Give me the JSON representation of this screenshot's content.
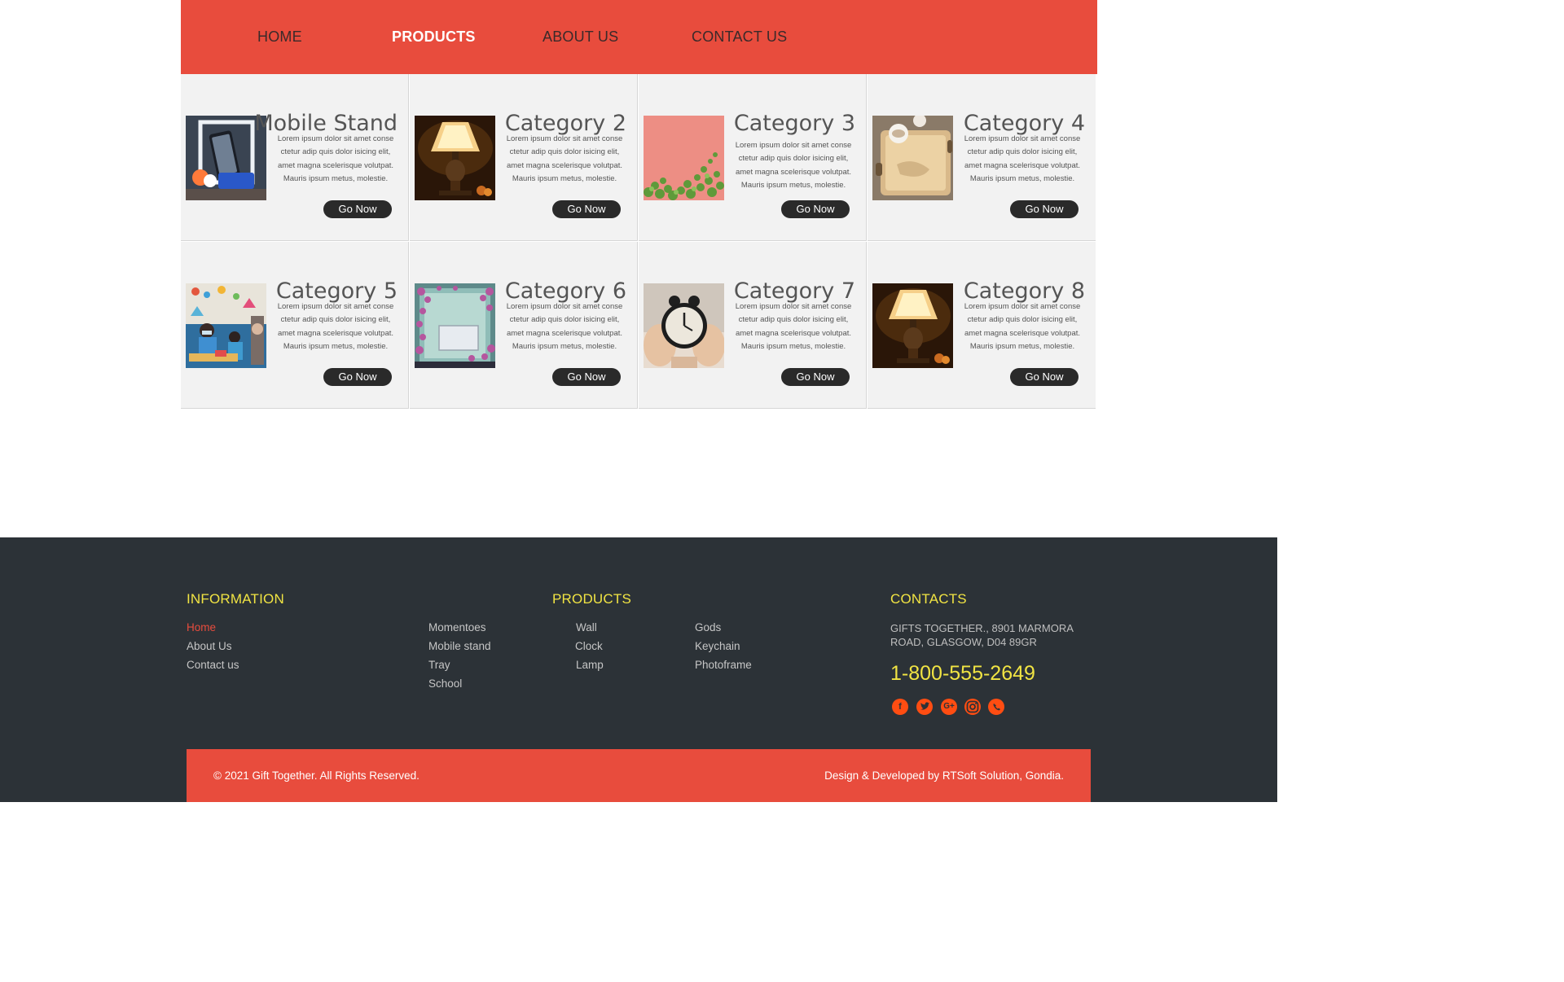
{
  "nav": {
    "items": [
      {
        "label": "HOME",
        "active": false
      },
      {
        "label": "PRODUCTS",
        "active": true
      },
      {
        "label": "ABOUT US",
        "active": false
      },
      {
        "label": "CONTACT US",
        "active": false
      }
    ]
  },
  "cards": [
    {
      "title": "Mobile Stand",
      "image": "mobile-stand",
      "desc": "Lorem ipsum dolor sit amet conse ctetur adip quis dolor isicing elit, amet magna scelerisque volutpat. Mauris ipsum metus, molestie.",
      "button": "Go Now"
    },
    {
      "title": "Category 2",
      "image": "lamp",
      "desc": "Lorem ipsum dolor sit amet conse ctetur adip quis dolor isicing elit, amet magna scelerisque volutpat. Mauris ipsum metus, molestie.",
      "button": "Go Now"
    },
    {
      "title": "Category 3",
      "image": "wall-vines",
      "desc": "Lorem ipsum dolor sit amet conse ctetur adip quis dolor isicing elit, amet magna scelerisque volutpat. Mauris ipsum metus, molestie.",
      "button": "Go Now"
    },
    {
      "title": "Category 4",
      "image": "tray",
      "desc": "Lorem ipsum dolor sit amet conse ctetur adip quis dolor isicing elit, amet magna scelerisque volutpat. Mauris ipsum metus, molestie.",
      "button": "Go Now"
    },
    {
      "title": "Category 5",
      "image": "school",
      "desc": "Lorem ipsum dolor sit amet conse ctetur adip quis dolor isicing elit, amet magna scelerisque volutpat. Mauris ipsum metus, molestie.",
      "button": "Go Now"
    },
    {
      "title": "Category 6",
      "image": "photoframe",
      "desc": "Lorem ipsum dolor sit amet conse ctetur adip quis dolor isicing elit, amet magna scelerisque volutpat. Mauris ipsum metus, molestie.",
      "button": "Go Now"
    },
    {
      "title": "Category 7",
      "image": "clock",
      "desc": "Lorem ipsum dolor sit amet conse ctetur adip quis dolor isicing elit, amet magna scelerisque volutpat. Mauris ipsum metus, molestie.",
      "button": "Go Now"
    },
    {
      "title": "Category 8",
      "image": "lamp",
      "desc": "Lorem ipsum dolor sit amet conse ctetur adip quis dolor isicing elit, amet magna scelerisque volutpat. Mauris ipsum metus, molestie.",
      "button": "Go Now"
    }
  ],
  "footer": {
    "information": {
      "heading": "INFORMATION",
      "links": [
        "Home",
        "About Us",
        "Contact us"
      ]
    },
    "products": {
      "heading": "PRODUCTS",
      "col1": [
        "Momentoes",
        "Mobile stand",
        "Tray",
        "School"
      ],
      "col2": [
        "Wall",
        "Clock",
        "Lamp"
      ],
      "col3": [
        "Gods",
        "Keychain",
        "Photoframe"
      ]
    },
    "contacts": {
      "heading": "CONTACTS",
      "address": "GIFTS TOGETHER., 8901 MARMORA ROAD, GLASGOW, D04 89GR",
      "phone": "1-800-555-2649",
      "social": [
        "facebook-icon",
        "twitter-icon",
        "google-plus-icon",
        "instagram-icon",
        "whatsapp-icon"
      ]
    },
    "copyright": "© 2021 Gift Together. All Rights Reserved.",
    "credit": "Design & Developed by RTSoft Solution, Gondia."
  },
  "colors": {
    "accent": "#e84c3d",
    "footer_bg": "#2c3237",
    "heading_yellow": "#f1e443",
    "social": "#ff4d12"
  }
}
